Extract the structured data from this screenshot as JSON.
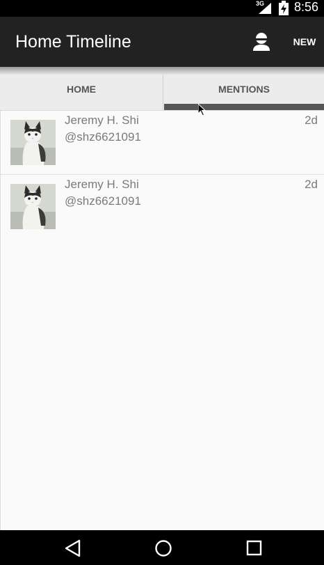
{
  "status_bar": {
    "network": "3G",
    "time": "8:56"
  },
  "action_bar": {
    "title": "Home Timeline",
    "new_label": "NEW",
    "profile_icon": "profile-icon"
  },
  "tabs": [
    {
      "label": "HOME",
      "selected": false
    },
    {
      "label": "MENTIONS",
      "selected": true
    }
  ],
  "tweets": [
    {
      "name": "Jeremy H. Shi",
      "handle": "@shz6621091",
      "age": "2d",
      "avatar": "cat-photo"
    },
    {
      "name": "Jeremy H. Shi",
      "handle": "@shz6621091",
      "age": "2d",
      "avatar": "cat-photo"
    }
  ],
  "nav_bar": {
    "icons": [
      "back-icon",
      "home-icon",
      "recents-icon"
    ]
  },
  "colors": {
    "action_bar": "#222222",
    "tab_indicator": "#575757",
    "secondary_text": "#7a7a7a"
  }
}
